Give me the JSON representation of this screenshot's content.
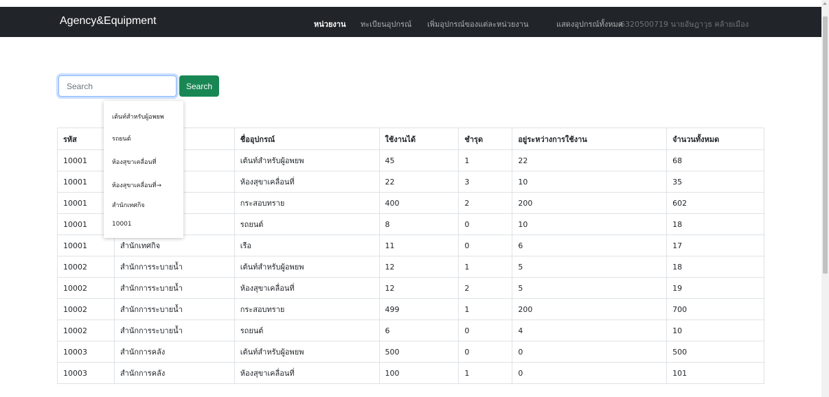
{
  "navbar": {
    "brand": "Agency&Equipment",
    "links": [
      "หน่วยงาน",
      "ทะเบียนอุปกรณ์",
      "เพิ่มอุปกรณ์ของแต่ละหน่วยงาน",
      "แสดงอุปกรณ์ทั้งหมด"
    ],
    "user": "6320500719 นายอัษฎาวุธ คล้ายเมือง"
  },
  "search": {
    "placeholder": "Search",
    "button_label": "Search"
  },
  "autocomplete": {
    "items": [
      "เต้นท์สำหรับผู้อพยพ",
      "รถยนต์",
      "ห้องสุขาเคลื่อนที่",
      "ห้องสุขาเคลื่อนที่→",
      "สำนักเทศกิจ",
      "10001"
    ]
  },
  "table": {
    "headers": [
      "รหัส",
      "",
      "ชื่ออุปกรณ์",
      "ใช้งานได้",
      "ชำรุด",
      "อยู่ระหว่างการใช้งาน",
      "จำนวนทั้งหมด"
    ],
    "rows": [
      [
        "10001",
        "",
        "เต้นท์สำหรับผู้อพยพ",
        "45",
        "1",
        "22",
        "68"
      ],
      [
        "10001",
        "",
        "ห้องสุขาเคลื่อนที่",
        "22",
        "3",
        "10",
        "35"
      ],
      [
        "10001",
        "",
        "กระสอบทราย",
        "400",
        "2",
        "200",
        "602"
      ],
      [
        "10001",
        "",
        "รถยนต์",
        "8",
        "0",
        "10",
        "18"
      ],
      [
        "10001",
        "สำนักเทศกิจ",
        "เรือ",
        "11",
        "0",
        "6",
        "17"
      ],
      [
        "10002",
        "สำนักการระบายน้ำ",
        "เต้นท์สำหรับผู้อพยพ",
        "12",
        "1",
        "5",
        "18"
      ],
      [
        "10002",
        "สำนักการระบายน้ำ",
        "ห้องสุขาเคลื่อนที่",
        "12",
        "2",
        "5",
        "19"
      ],
      [
        "10002",
        "สำนักการระบายน้ำ",
        "กระสอบทราย",
        "499",
        "1",
        "200",
        "700"
      ],
      [
        "10002",
        "สำนักการระบายน้ำ",
        "รถยนต์",
        "6",
        "0",
        "4",
        "10"
      ],
      [
        "10003",
        "สำนักการคลัง",
        "เต้นท์สำหรับผู้อพยพ",
        "500",
        "0",
        "0",
        "500"
      ],
      [
        "10003",
        "สำนักการคลัง",
        "ห้องสุขาเคลื่อนที่",
        "100",
        "1",
        "0",
        "101"
      ]
    ]
  },
  "colors": {
    "navbar_bg": "#212529",
    "search_button": "#198754",
    "input_focus": "#86b7fe"
  }
}
